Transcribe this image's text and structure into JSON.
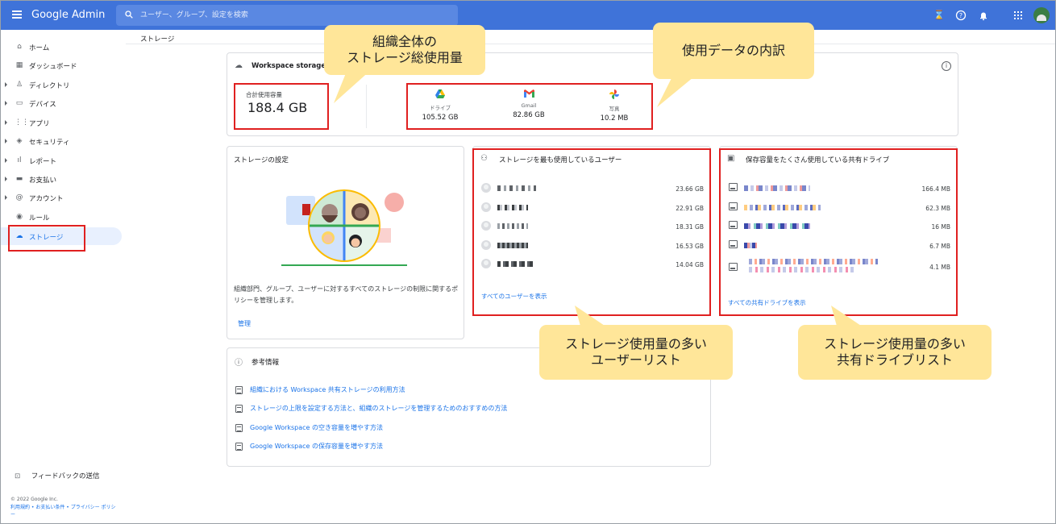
{
  "app": {
    "brand": "Google Admin"
  },
  "search": {
    "placeholder": "ユーザー、グループ、設定を検索"
  },
  "top_icons": [
    "hourglass-icon",
    "help-icon",
    "bell-icon",
    "apps-grid-icon"
  ],
  "sidebar": {
    "items": [
      {
        "label": "ホーム",
        "icon": "home-icon",
        "expandable": false
      },
      {
        "label": "ダッシュボード",
        "icon": "dashboard-icon",
        "expandable": false
      },
      {
        "label": "ディレクトリ",
        "icon": "person-icon",
        "expandable": true
      },
      {
        "label": "デバイス",
        "icon": "devices-icon",
        "expandable": true
      },
      {
        "label": "アプリ",
        "icon": "apps-icon",
        "expandable": true
      },
      {
        "label": "セキュリティ",
        "icon": "shield-icon",
        "expandable": true
      },
      {
        "label": "レポート",
        "icon": "bar-chart-icon",
        "expandable": true
      },
      {
        "label": "お支払い",
        "icon": "credit-card-icon",
        "expandable": true
      },
      {
        "label": "アカウント",
        "icon": "at-icon",
        "expandable": true
      },
      {
        "label": "ルール",
        "icon": "rules-icon",
        "expandable": false
      },
      {
        "label": "ストレージ",
        "icon": "cloud-icon",
        "expandable": false,
        "active": true
      }
    ],
    "feedback": "フィードバックの送信",
    "copyright": "© 2022 Google Inc.",
    "legal": "利用規約 • お支払い条件 • プライバシー ポリシー"
  },
  "breadcrumb": "ストレージ",
  "storage": {
    "title": "Workspace storage",
    "total_label": "合計使用容量",
    "total_value": "188.4 GB",
    "services": [
      {
        "label": "ドライブ",
        "value": "105.52 GB",
        "icon": "drive-icon"
      },
      {
        "label": "Gmail",
        "value": "82.86 GB",
        "icon": "gmail-icon"
      },
      {
        "label": "写真",
        "value": "10.2 MB",
        "icon": "photos-icon"
      }
    ]
  },
  "settings": {
    "title": "ストレージの設定",
    "description": "組織部門、グループ、ユーザーに対するすべてのストレージの制限に関するポリシーを管理します。",
    "manage_link": "管理"
  },
  "top_users": {
    "title": "ストレージを最も使用しているユーザー",
    "rows": [
      "23.66 GB",
      "22.91 GB",
      "18.31 GB",
      "16.53 GB",
      "14.04 GB"
    ],
    "link": "すべてのユーザーを表示"
  },
  "top_drives": {
    "title": "保存容量をたくさん使用している共有ドライブ",
    "rows": [
      "166.4 MB",
      "62.3 MB",
      "16 MB",
      "6.7 MB",
      "4.1 MB"
    ],
    "link": "すべての共有ドライブを表示"
  },
  "reference": {
    "title": "参考情報",
    "links": [
      "組織における Workspace 共有ストレージの利用方法",
      "ストレージの上限を設定する方法と、組織のストレージを管理するためのおすすめの方法",
      "Google Workspace の空き容量を増やす方法",
      "Google Workspace の保存容量を増やす方法"
    ]
  },
  "callouts": {
    "total": [
      "組織全体の",
      "ストレージ総使用量"
    ],
    "breakdown": [
      "使用データの内訳"
    ],
    "users": [
      "ストレージ使用量の多い",
      "ユーザーリスト"
    ],
    "drives": [
      "ストレージ使用量の多い",
      "共有ドライブリスト"
    ]
  },
  "colors": {
    "topbar": "#3f73d9",
    "accent": "#1a73e8",
    "callout": "#ffe699",
    "highlight": "#e02020"
  }
}
